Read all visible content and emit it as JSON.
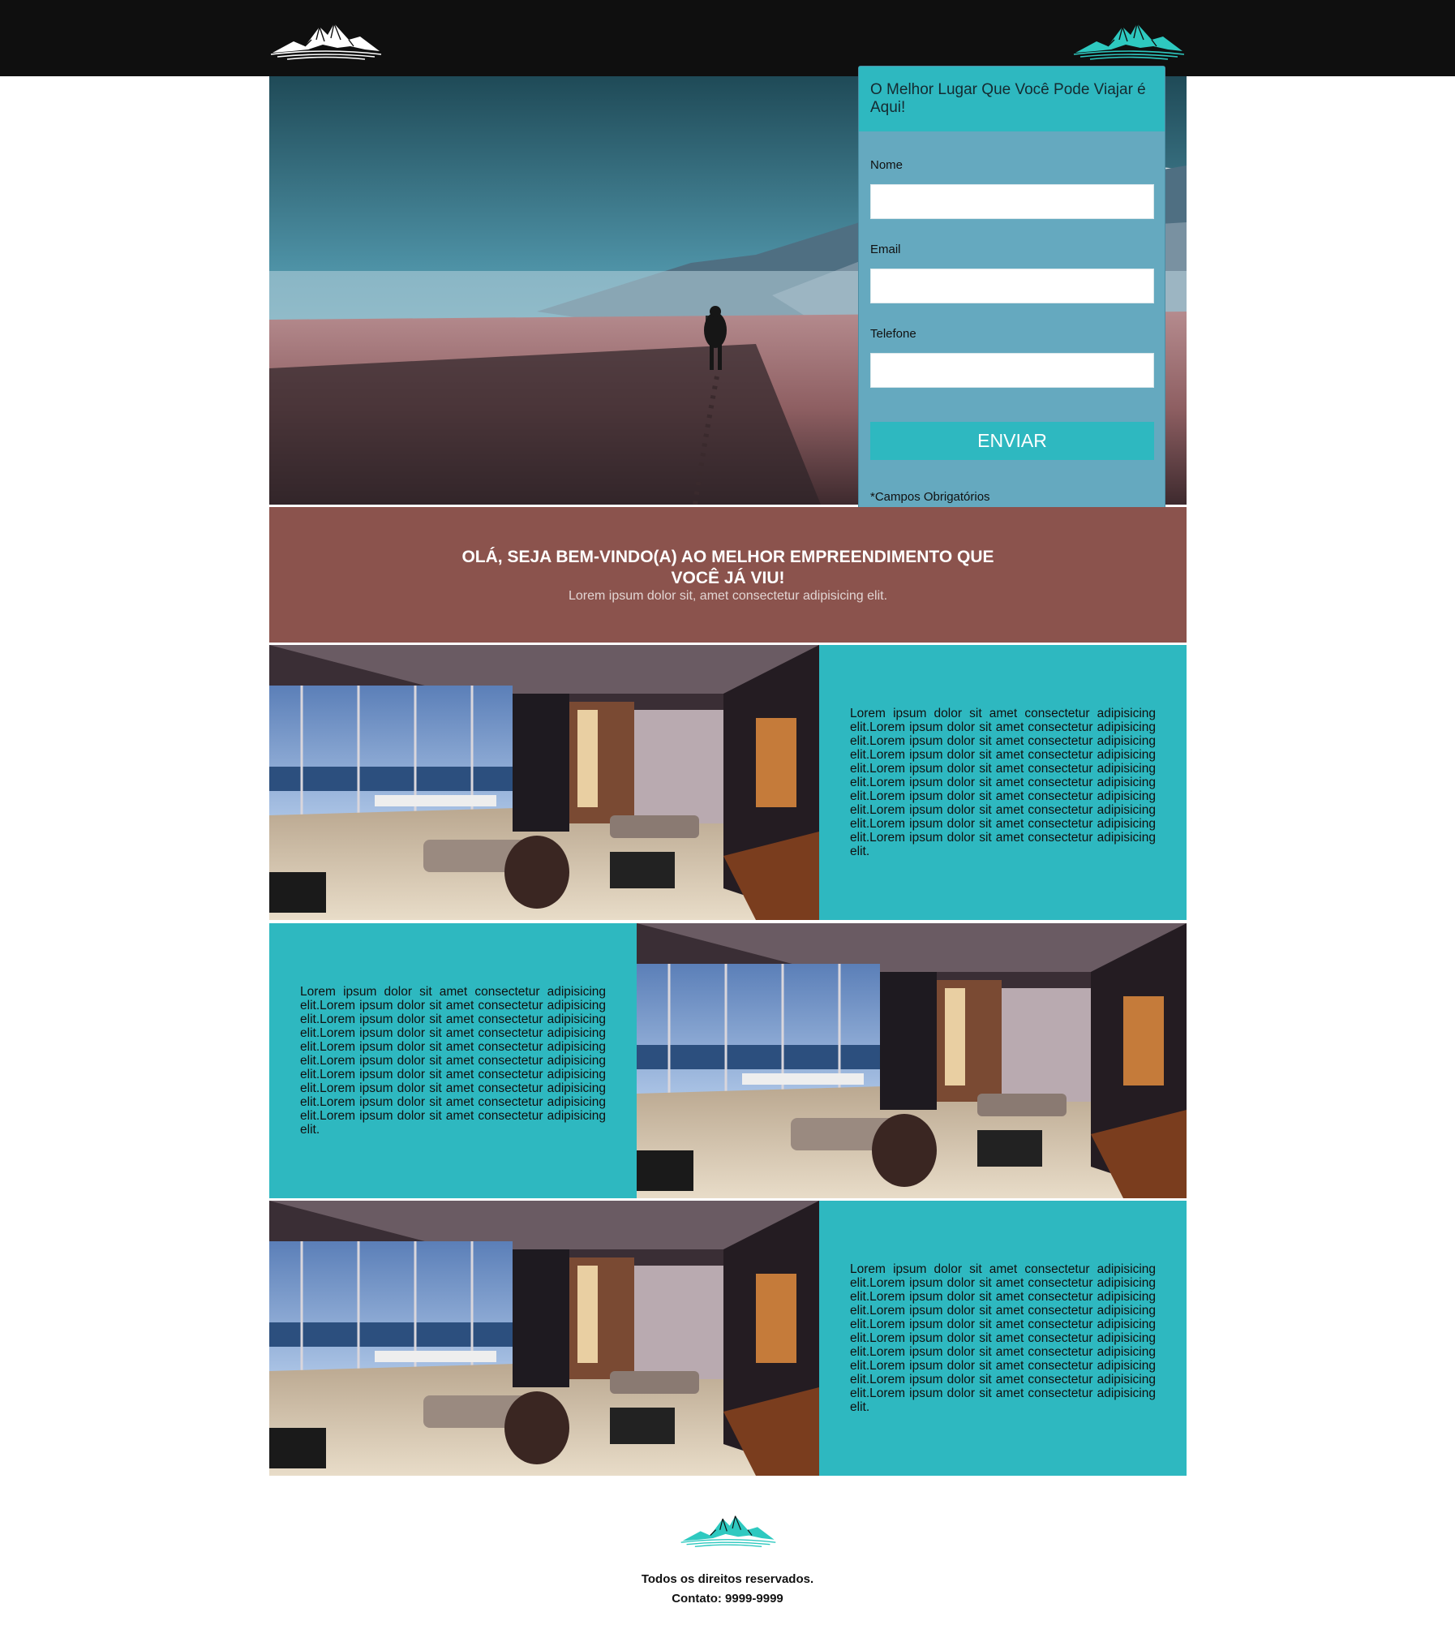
{
  "header": {
    "logo_left_icon": "mountain-logo-white-icon",
    "logo_right_icon": "mountain-logo-teal-icon"
  },
  "hero": {
    "image": "beach-walker-photo"
  },
  "form": {
    "title": "O Melhor Lugar Que Você Pode Viajar é Aqui!",
    "name_label": "Nome",
    "name_value": "",
    "email_label": "Email",
    "email_value": "",
    "phone_label": "Telefone",
    "phone_value": "",
    "submit_label": "ENVIAR",
    "required_note": "*Campos Obrigatórios"
  },
  "welcome": {
    "title": "OLÁ, SEJA BEM-VINDO(A) AO MELHOR EMPREENDIMENTO QUE VOCÊ JÁ VIU!",
    "subtitle": "Lorem ipsum dolor sit, amet consectetur adipisicing elit."
  },
  "features": [
    {
      "image": "living-room-render-photo",
      "text": "Lorem ipsum dolor sit amet consectetur adipisicing elit.Lorem ipsum dolor sit amet consectetur adipisicing elit.Lorem ipsum dolor sit amet consectetur adipisicing elit.Lorem ipsum dolor sit amet consectetur adipisicing elit.Lorem ipsum dolor sit amet consectetur adipisicing elit.Lorem ipsum dolor sit amet consectetur adipisicing elit.Lorem ipsum dolor sit amet consectetur adipisicing elit.Lorem ipsum dolor sit amet consectetur adipisicing elit.Lorem ipsum dolor sit amet consectetur adipisicing elit.Lorem ipsum dolor sit amet consectetur adipisicing elit."
    },
    {
      "image": "living-room-render-photo",
      "text": "Lorem ipsum dolor sit amet consectetur adipisicing elit.Lorem ipsum dolor sit amet consectetur adipisicing elit.Lorem ipsum dolor sit amet consectetur adipisicing elit.Lorem ipsum dolor sit amet consectetur adipisicing elit.Lorem ipsum dolor sit amet consectetur adipisicing elit.Lorem ipsum dolor sit amet consectetur adipisicing elit.Lorem ipsum dolor sit amet consectetur adipisicing elit.Lorem ipsum dolor sit amet consectetur adipisicing elit.Lorem ipsum dolor sit amet consectetur adipisicing elit.Lorem ipsum dolor sit amet consectetur adipisicing elit."
    },
    {
      "image": "living-room-render-photo",
      "text": "Lorem ipsum dolor sit amet consectetur adipisicing elit.Lorem ipsum dolor sit amet consectetur adipisicing elit.Lorem ipsum dolor sit amet consectetur adipisicing elit.Lorem ipsum dolor sit amet consectetur adipisicing elit.Lorem ipsum dolor sit amet consectetur adipisicing elit.Lorem ipsum dolor sit amet consectetur adipisicing elit.Lorem ipsum dolor sit amet consectetur adipisicing elit.Lorem ipsum dolor sit amet consectetur adipisicing elit.Lorem ipsum dolor sit amet consectetur adipisicing elit.Lorem ipsum dolor sit amet consectetur adipisicing elit."
    }
  ],
  "footer": {
    "logo_icon": "mountain-logo-teal-icon",
    "rights": "Todos os direitos reservados.",
    "contact": "Contato: 9999-9999"
  },
  "colors": {
    "header_bg": "#0f0f0f",
    "teal": "#2eb8c0",
    "form_bg": "#65a9bf",
    "welcome_bg": "#8b534d"
  }
}
